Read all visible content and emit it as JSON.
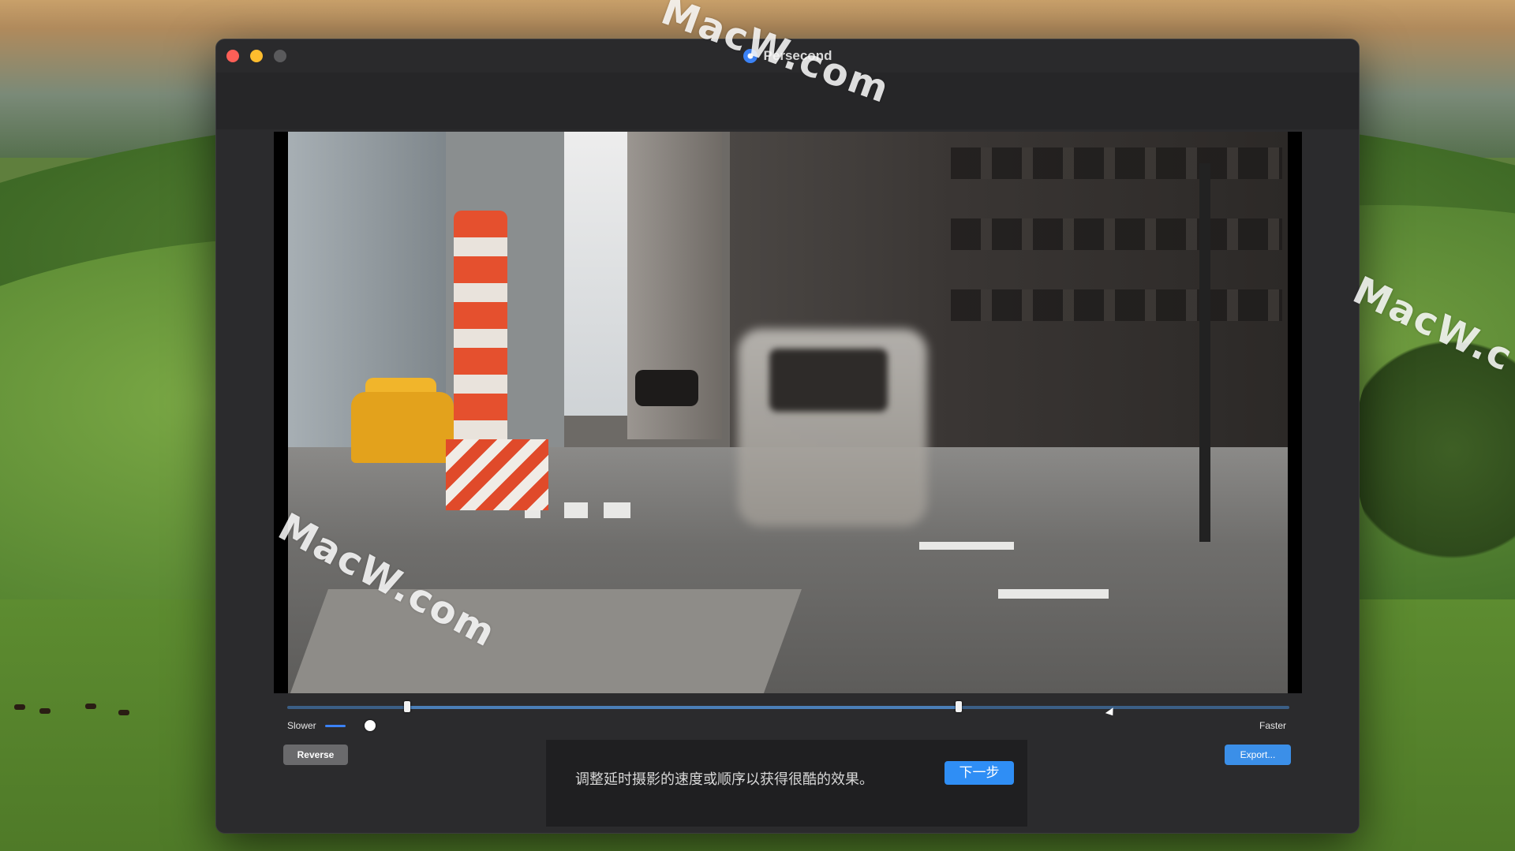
{
  "window": {
    "title": "Persecond"
  },
  "watermarks": [
    "MacW.com",
    "MacW.c",
    "MacW.com"
  ],
  "timeline": {
    "in_point": 0.12,
    "out_point": 0.67
  },
  "speed": {
    "slower_label": "Slower",
    "faster_label": "Faster",
    "level": 0.04
  },
  "buttons": {
    "reverse_label": "Reverse",
    "export_label": "Export...",
    "next_label": "下一步"
  },
  "caption": {
    "text": "调整延时摄影的速度或顺序以获得很酷的效果。"
  },
  "colors": {
    "accent": "#3b8fe8",
    "close": "#fe5f57",
    "minimize": "#febc2e"
  },
  "icons": {
    "app": "persecond-icon",
    "traffic": [
      "close-icon",
      "minimize-icon",
      "maximize-icon"
    ]
  }
}
